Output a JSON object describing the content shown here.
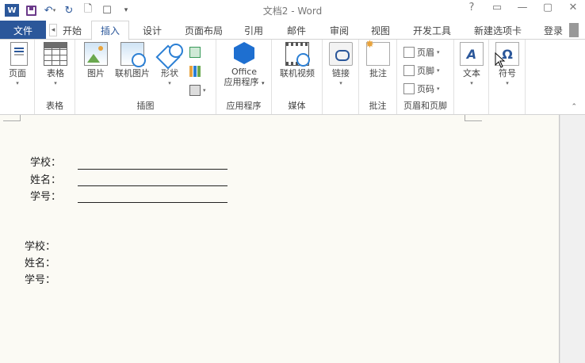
{
  "window": {
    "title": "文档2 - Word",
    "app_icon": "W",
    "controls": [
      "?",
      "▭",
      "—",
      "▢",
      "✕"
    ]
  },
  "tabs": {
    "file": "文件",
    "items": [
      "开始",
      "插入",
      "设计",
      "页面布局",
      "引用",
      "邮件",
      "审阅",
      "视图",
      "开发工具",
      "新建选项卡"
    ],
    "active": "插入",
    "login": "登录"
  },
  "ribbon": {
    "groups": {
      "pages": {
        "button": "页面"
      },
      "tables": {
        "button": "表格",
        "label": "表格"
      },
      "illustrations": {
        "pictures": "图片",
        "online_pictures": "联机图片",
        "shapes": "形状",
        "label": "插图"
      },
      "apps": {
        "button_line1": "Office",
        "button_line2": "应用程序",
        "label": "应用程序"
      },
      "media": {
        "button": "联机视频",
        "label": "媒体"
      },
      "links": {
        "button": "链接"
      },
      "comments": {
        "button": "批注",
        "label": "批注"
      },
      "header_footer": {
        "header": "页眉",
        "footer": "页脚",
        "page_number": "页码",
        "label": "页眉和页脚"
      },
      "text": {
        "button": "文本"
      },
      "symbols": {
        "button": "符号"
      }
    }
  },
  "document": {
    "block1": {
      "school": "学校：",
      "name": "姓名：",
      "id": "学号："
    },
    "block2": {
      "school": "学校：",
      "name": "姓名：",
      "id": "学号："
    }
  }
}
